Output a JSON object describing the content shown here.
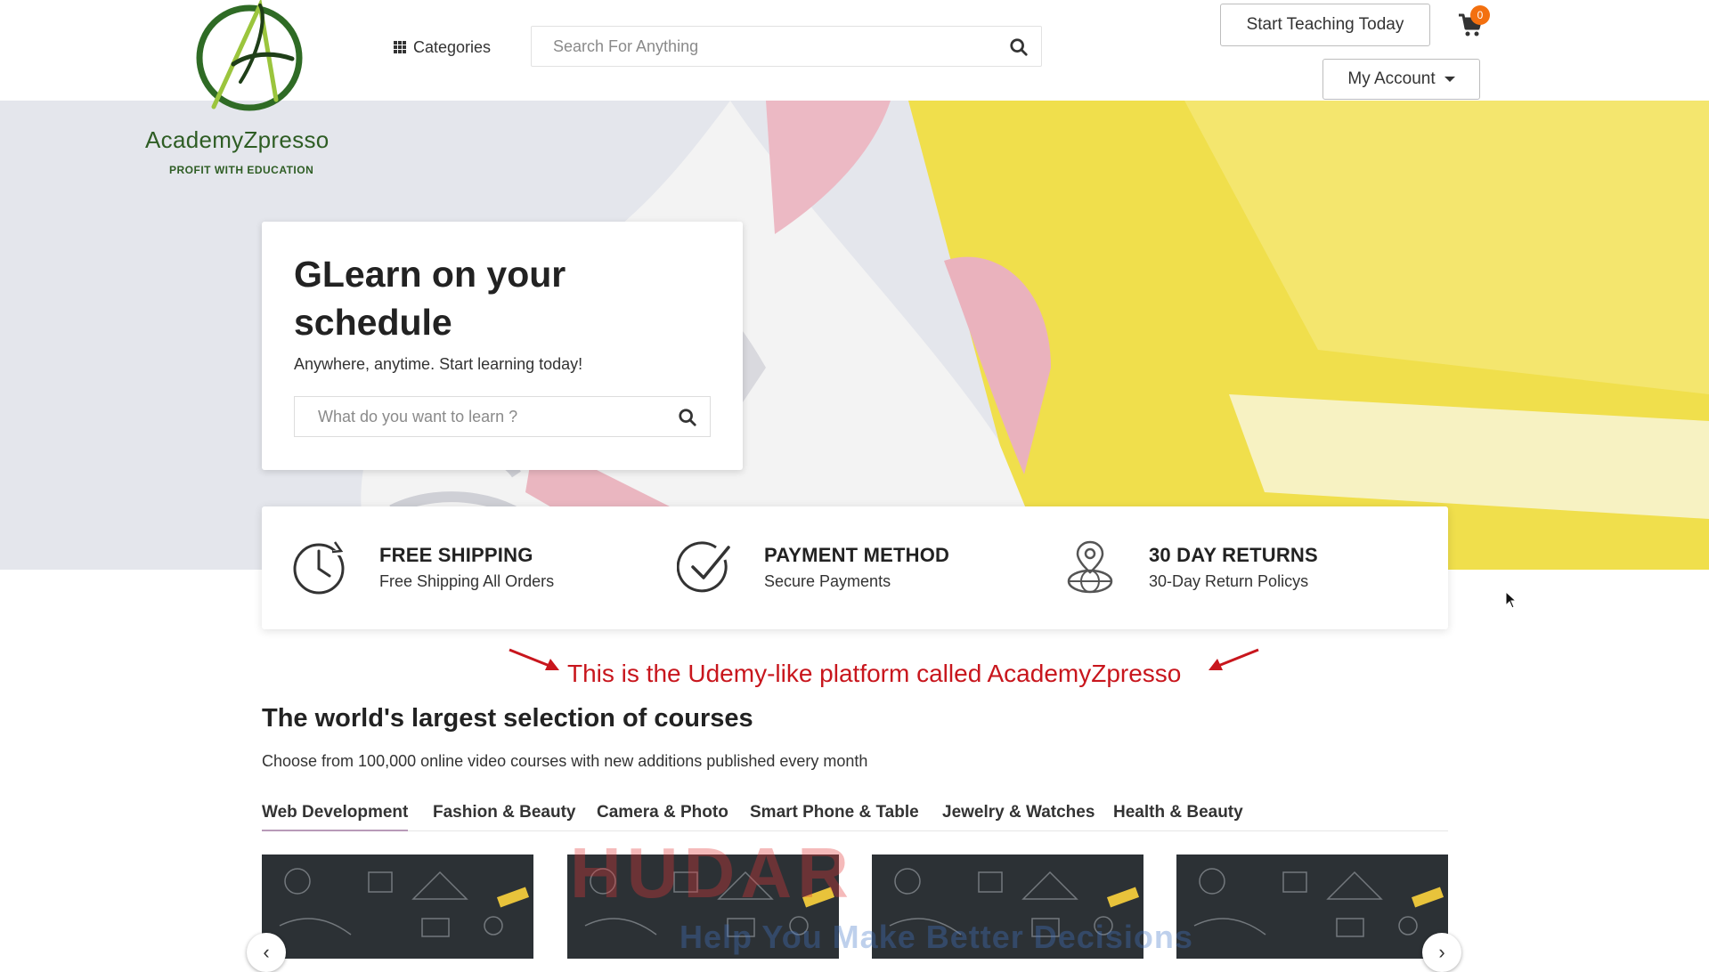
{
  "header": {
    "brand_name": "AcademyZpresso",
    "brand_tagline": "PROFIT WITH EDUCATION",
    "categories_label": "Categories",
    "search_placeholder": "Search For Anything",
    "teach_label": "Start Teaching Today",
    "cart_count": "0",
    "account_label": "My Account"
  },
  "hero": {
    "title": "GLearn on your schedule",
    "subtitle": "Anywhere, anytime. Start learning today!",
    "search_placeholder": "What do you want to learn ?"
  },
  "features": [
    {
      "icon": "clock-icon",
      "title": "FREE SHIPPING",
      "subtitle": "Free Shipping All Orders"
    },
    {
      "icon": "checkmark-circle-icon",
      "title": "PAYMENT METHOD",
      "subtitle": "Secure Payments"
    },
    {
      "icon": "globe-pin-icon",
      "title": "30 DAY RETURNS",
      "subtitle": "30-Day Return Policys"
    }
  ],
  "annotation": "This is the Udemy-like platform called AcademyZpresso",
  "courses": {
    "title": "The world's largest selection of courses",
    "subtitle": "Choose from 100,000 online video courses with new additions published every month",
    "tabs": [
      "Web Development",
      "Fashion & Beauty",
      "Camera & Photo",
      "Smart Phone & Table",
      "Jewelry & Watches",
      "Health & Beauty"
    ],
    "active_tab": "Web Development"
  },
  "watermark": {
    "main": "HUDAR",
    "sub": "Help You Make Better Decisions"
  },
  "colors": {
    "accent_badge": "#f3700f",
    "annotation": "#c8161d",
    "brand_green": "#2e5d24"
  }
}
